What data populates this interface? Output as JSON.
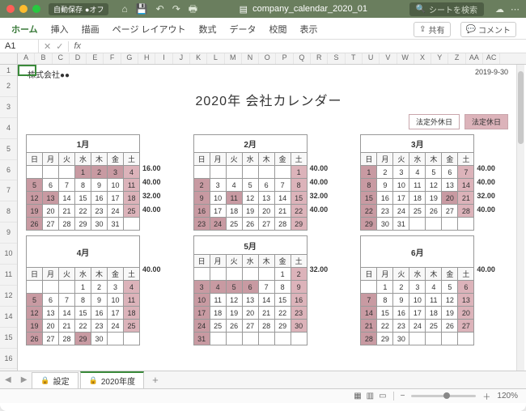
{
  "titlebar": {
    "autosave_label": "自動保存",
    "autosave_state": "●オフ",
    "filename": "company_calendar_2020_01",
    "search_placeholder": "シートを検索"
  },
  "ribbon": {
    "tabs": [
      "ホーム",
      "挿入",
      "描画",
      "ページ レイアウト",
      "数式",
      "データ",
      "校閲",
      "表示"
    ],
    "share": "共有",
    "comment": "コメント"
  },
  "formula": {
    "cell": "A1",
    "fx": "fx"
  },
  "columns": [
    "A",
    "B",
    "C",
    "D",
    "E",
    "F",
    "G",
    "H",
    "I",
    "J",
    "K",
    "L",
    "M",
    "N",
    "O",
    "P",
    "Q",
    "R",
    "S",
    "T",
    "U",
    "V",
    "W",
    "X",
    "Y",
    "Z",
    "AA",
    "AC"
  ],
  "rows": [
    "1",
    "2",
    "3",
    "4",
    "5",
    "6",
    "7",
    "8",
    "9",
    "10",
    "11",
    "12",
    "14",
    "15",
    "16"
  ],
  "doc": {
    "company": "株式会社●●",
    "print_date": "2019-9-30",
    "title": "2020年 会社カレンダー",
    "legend_extra": "法定外休日",
    "legend_hol": "法定休日",
    "dow": [
      "日",
      "月",
      "火",
      "水",
      "木",
      "金",
      "土"
    ]
  },
  "months": [
    {
      "name": "1月",
      "rows": [
        [
          "",
          "",
          "",
          "1",
          "2",
          "3",
          "4",
          "16.00"
        ],
        [
          "5",
          "6",
          "7",
          "8",
          "9",
          "10",
          "11",
          "40.00"
        ],
        [
          "12",
          "13",
          "14",
          "15",
          "16",
          "17",
          "18",
          "32.00"
        ],
        [
          "19",
          "20",
          "21",
          "22",
          "23",
          "24",
          "25",
          "40.00"
        ],
        [
          "26",
          "27",
          "28",
          "29",
          "30",
          "31",
          "",
          ""
        ]
      ],
      "h2": [
        [
          0,
          3
        ],
        [
          0,
          4
        ],
        [
          0,
          5
        ],
        [
          1,
          0
        ],
        [
          2,
          0
        ],
        [
          2,
          1
        ],
        [
          3,
          0
        ],
        [
          4,
          0
        ]
      ],
      "h": [
        [
          0,
          6
        ],
        [
          1,
          6
        ],
        [
          2,
          6
        ],
        [
          3,
          6
        ]
      ]
    },
    {
      "name": "2月",
      "rows": [
        [
          "",
          "",
          "",
          "",
          "",
          "",
          "1",
          "40.00"
        ],
        [
          "2",
          "3",
          "4",
          "5",
          "6",
          "7",
          "8",
          "40.00"
        ],
        [
          "9",
          "10",
          "11",
          "12",
          "13",
          "14",
          "15",
          "32.00"
        ],
        [
          "16",
          "17",
          "18",
          "19",
          "20",
          "21",
          "22",
          "40.00"
        ],
        [
          "23",
          "24",
          "25",
          "26",
          "27",
          "28",
          "29",
          ""
        ]
      ],
      "h2": [
        [
          1,
          0
        ],
        [
          2,
          0
        ],
        [
          2,
          2
        ],
        [
          3,
          0
        ],
        [
          4,
          0
        ],
        [
          4,
          1
        ]
      ],
      "h": [
        [
          0,
          6
        ],
        [
          1,
          6
        ],
        [
          2,
          6
        ],
        [
          3,
          6
        ],
        [
          4,
          6
        ]
      ]
    },
    {
      "name": "3月",
      "rows": [
        [
          "1",
          "2",
          "3",
          "4",
          "5",
          "6",
          "7",
          "40.00"
        ],
        [
          "8",
          "9",
          "10",
          "11",
          "12",
          "13",
          "14",
          "40.00"
        ],
        [
          "15",
          "16",
          "17",
          "18",
          "19",
          "20",
          "21",
          "32.00"
        ],
        [
          "22",
          "23",
          "24",
          "25",
          "26",
          "27",
          "28",
          "40.00"
        ],
        [
          "29",
          "30",
          "31",
          "",
          "",
          "",
          "",
          ""
        ]
      ],
      "h2": [
        [
          0,
          0
        ],
        [
          1,
          0
        ],
        [
          2,
          0
        ],
        [
          2,
          5
        ],
        [
          3,
          0
        ],
        [
          4,
          0
        ]
      ],
      "h": [
        [
          0,
          6
        ],
        [
          1,
          6
        ],
        [
          2,
          6
        ],
        [
          3,
          6
        ]
      ]
    },
    {
      "name": "4月",
      "rows": [
        [
          "",
          "",
          "",
          "1",
          "2",
          "3",
          "4",
          "40.00"
        ],
        [
          "5",
          "6",
          "7",
          "8",
          "9",
          "10",
          "11",
          ""
        ],
        [
          "12",
          "13",
          "14",
          "15",
          "16",
          "17",
          "18",
          ""
        ],
        [
          "19",
          "20",
          "21",
          "22",
          "23",
          "24",
          "25",
          ""
        ],
        [
          "26",
          "27",
          "28",
          "29",
          "30",
          "",
          ""
        ]
      ],
      "h2": [
        [
          1,
          0
        ],
        [
          2,
          0
        ],
        [
          3,
          0
        ],
        [
          4,
          0
        ],
        [
          4,
          3
        ]
      ],
      "h": [
        [
          0,
          6
        ],
        [
          1,
          6
        ],
        [
          2,
          6
        ],
        [
          3,
          6
        ]
      ]
    },
    {
      "name": "5月",
      "rows": [
        [
          "",
          "",
          "",
          "",
          "",
          "1",
          "2",
          "32.00"
        ],
        [
          "3",
          "4",
          "5",
          "6",
          "7",
          "8",
          "9",
          ""
        ],
        [
          "10",
          "11",
          "12",
          "13",
          "14",
          "15",
          "16",
          ""
        ],
        [
          "17",
          "18",
          "19",
          "20",
          "21",
          "22",
          "23",
          ""
        ],
        [
          "24",
          "25",
          "26",
          "27",
          "28",
          "29",
          "30",
          ""
        ],
        [
          "31",
          "",
          "",
          "",
          "",
          "",
          "",
          ""
        ]
      ],
      "h2": [
        [
          1,
          0
        ],
        [
          1,
          1
        ],
        [
          1,
          2
        ],
        [
          1,
          3
        ],
        [
          2,
          0
        ],
        [
          3,
          0
        ],
        [
          4,
          0
        ],
        [
          5,
          0
        ]
      ],
      "h": [
        [
          0,
          6
        ],
        [
          1,
          6
        ],
        [
          2,
          6
        ],
        [
          3,
          6
        ],
        [
          4,
          6
        ]
      ]
    },
    {
      "name": "6月",
      "rows": [
        [
          "",
          "1",
          "2",
          "3",
          "4",
          "5",
          "6",
          "40.00"
        ],
        [
          "7",
          "8",
          "9",
          "10",
          "11",
          "12",
          "13",
          ""
        ],
        [
          "14",
          "15",
          "16",
          "17",
          "18",
          "19",
          "20",
          ""
        ],
        [
          "21",
          "22",
          "23",
          "24",
          "25",
          "26",
          "27",
          ""
        ],
        [
          "28",
          "29",
          "30",
          "",
          "",
          "",
          "",
          ""
        ]
      ],
      "h2": [
        [
          1,
          0
        ],
        [
          2,
          0
        ],
        [
          3,
          0
        ],
        [
          4,
          0
        ]
      ],
      "h": [
        [
          0,
          6
        ],
        [
          1,
          6
        ],
        [
          2,
          6
        ],
        [
          3,
          6
        ]
      ]
    }
  ],
  "sheetTabs": {
    "tab1": "設定",
    "tab2": "2020年度"
  },
  "status": {
    "zoom": "120%"
  }
}
